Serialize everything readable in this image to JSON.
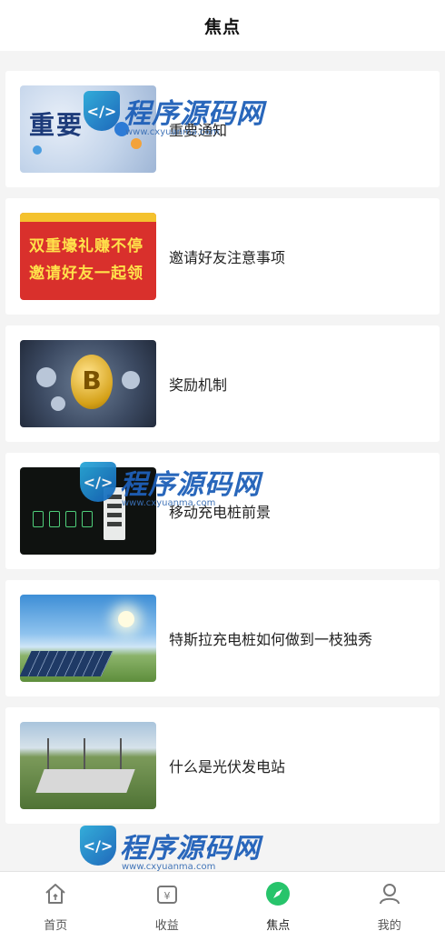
{
  "header": {
    "title": "焦点"
  },
  "articles": [
    {
      "title": "重要通知",
      "thumb_text": "重要"
    },
    {
      "title": "邀请好友注意事项",
      "thumb_lines": [
        "双重壕礼赚不停",
        "邀请好友一起领"
      ]
    },
    {
      "title": "奖励机制",
      "thumb_symbol": "B"
    },
    {
      "title": "移动充电桩前景"
    },
    {
      "title": "特斯拉充电桩如何做到一枝独秀"
    },
    {
      "title": "什么是光伏发电站"
    }
  ],
  "watermark": {
    "brand": "程序源码网",
    "url": "www.cxyuanma.com"
  },
  "nav": {
    "items": [
      {
        "label": "首页",
        "icon": "home-icon"
      },
      {
        "label": "收益",
        "icon": "wallet-icon"
      },
      {
        "label": "焦点",
        "icon": "compass-icon",
        "active": true
      },
      {
        "label": "我的",
        "icon": "user-icon"
      }
    ],
    "active_color": "#27c46b"
  }
}
